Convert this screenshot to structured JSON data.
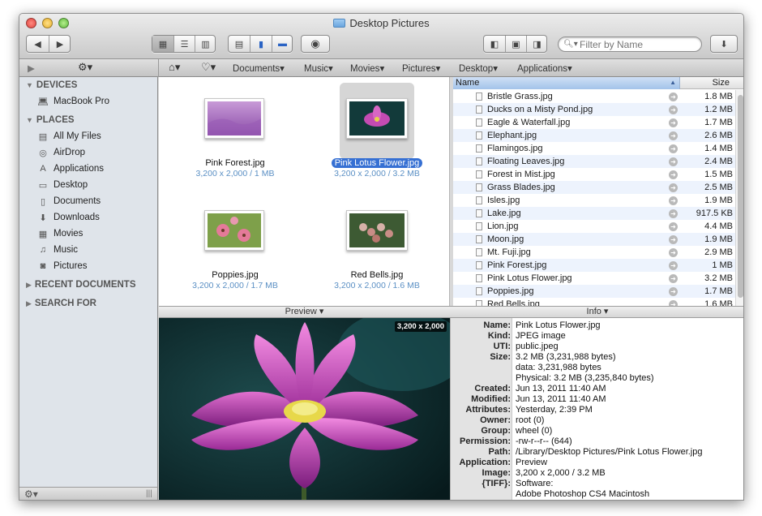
{
  "window": {
    "title": "Desktop Pictures"
  },
  "toolbar": {
    "back": "◀",
    "forward": "▶",
    "view_icon": "icon-view",
    "view_list": "list-view",
    "view_column": "column-view",
    "search_placeholder": "Filter by Name"
  },
  "pathbar": {
    "items": [
      "Documents",
      "Music",
      "Movies",
      "Pictures",
      "Desktop",
      "Applications"
    ]
  },
  "sidebar": {
    "devices_header": "DEVICES",
    "devices": [
      {
        "label": "MacBook Pro",
        "icon": "laptop-icon"
      }
    ],
    "places_header": "PLACES",
    "places": [
      {
        "label": "All My Files",
        "icon": "all-files-icon"
      },
      {
        "label": "AirDrop",
        "icon": "airdrop-icon"
      },
      {
        "label": "Applications",
        "icon": "applications-icon"
      },
      {
        "label": "Desktop",
        "icon": "desktop-icon"
      },
      {
        "label": "Documents",
        "icon": "documents-icon"
      },
      {
        "label": "Downloads",
        "icon": "downloads-icon"
      },
      {
        "label": "Movies",
        "icon": "movies-icon"
      },
      {
        "label": "Music",
        "icon": "music-icon"
      },
      {
        "label": "Pictures",
        "icon": "pictures-icon"
      }
    ],
    "recent_header": "RECENT DOCUMENTS",
    "search_header": "SEARCH FOR"
  },
  "iconview": {
    "items": [
      {
        "name": "Pink Forest.jpg",
        "meta": "3,200 x 2,000 / 1 MB",
        "selected": false
      },
      {
        "name": "Pink Lotus Flower.jpg",
        "meta": "3,200 x 2,000 / 3.2 MB",
        "selected": true
      },
      {
        "name": "Poppies.jpg",
        "meta": "3,200 x 2,000 / 1.7 MB",
        "selected": false
      },
      {
        "name": "Red Bells.jpg",
        "meta": "3,200 x 2,000 / 1.6 MB",
        "selected": false
      }
    ]
  },
  "list": {
    "col_name": "Name",
    "col_size": "Size",
    "rows": [
      {
        "name": "Bristle Grass.jpg",
        "size": "1.8 MB"
      },
      {
        "name": "Ducks on a Misty Pond.jpg",
        "size": "1.2 MB"
      },
      {
        "name": "Eagle & Waterfall.jpg",
        "size": "1.7 MB"
      },
      {
        "name": "Elephant.jpg",
        "size": "2.6 MB"
      },
      {
        "name": "Flamingos.jpg",
        "size": "1.4 MB"
      },
      {
        "name": "Floating Leaves.jpg",
        "size": "2.4 MB"
      },
      {
        "name": "Forest in Mist.jpg",
        "size": "1.5 MB"
      },
      {
        "name": "Grass Blades.jpg",
        "size": "2.5 MB"
      },
      {
        "name": "Isles.jpg",
        "size": "1.9 MB"
      },
      {
        "name": "Lake.jpg",
        "size": "917.5 KB"
      },
      {
        "name": "Lion.jpg",
        "size": "4.4 MB"
      },
      {
        "name": "Moon.jpg",
        "size": "1.9 MB"
      },
      {
        "name": "Mt. Fuji.jpg",
        "size": "2.9 MB"
      },
      {
        "name": "Pink Forest.jpg",
        "size": "1 MB"
      },
      {
        "name": "Pink Lotus Flower.jpg",
        "size": "3.2 MB"
      },
      {
        "name": "Poppies.jpg",
        "size": "1.7 MB"
      },
      {
        "name": "Red Bells.jpg",
        "size": "1.6 MB"
      }
    ]
  },
  "preview": {
    "header": "Preview ▾",
    "badge": "3,200 x 2,000"
  },
  "info": {
    "header": "Info ▾",
    "rows": [
      {
        "k": "Name:",
        "v": "Pink Lotus Flower.jpg"
      },
      {
        "k": "Kind:",
        "v": "JPEG image"
      },
      {
        "k": "UTI:",
        "v": "public.jpeg"
      },
      {
        "k": "Size:",
        "v": "3.2 MB (3,231,988 bytes)"
      },
      {
        "k": "",
        "v": "data: 3,231,988 bytes"
      },
      {
        "k": "",
        "v": "Physical: 3.2 MB (3,235,840 bytes)"
      },
      {
        "k": "Created:",
        "v": "Jun 13, 2011 11:40 AM"
      },
      {
        "k": "Modified:",
        "v": "Jun 13, 2011 11:40 AM"
      },
      {
        "k": "Attributes:",
        "v": "Yesterday, 2:39 PM"
      },
      {
        "k": "Owner:",
        "v": "root (0)"
      },
      {
        "k": "Group:",
        "v": "wheel (0)"
      },
      {
        "k": "Permission:",
        "v": "-rw-r--r-- (644)"
      },
      {
        "k": "Path:",
        "v": "/Library/Desktop Pictures/Pink Lotus Flower.jpg"
      },
      {
        "k": "Application:",
        "v": "Preview"
      },
      {
        "k": "Image:",
        "v": "3,200 x 2,000 / 3.2 MB"
      },
      {
        "k": "{TIFF}:",
        "v": "Software:"
      },
      {
        "k": "",
        "v": "        Adobe Photoshop CS4 Macintosh"
      }
    ]
  }
}
